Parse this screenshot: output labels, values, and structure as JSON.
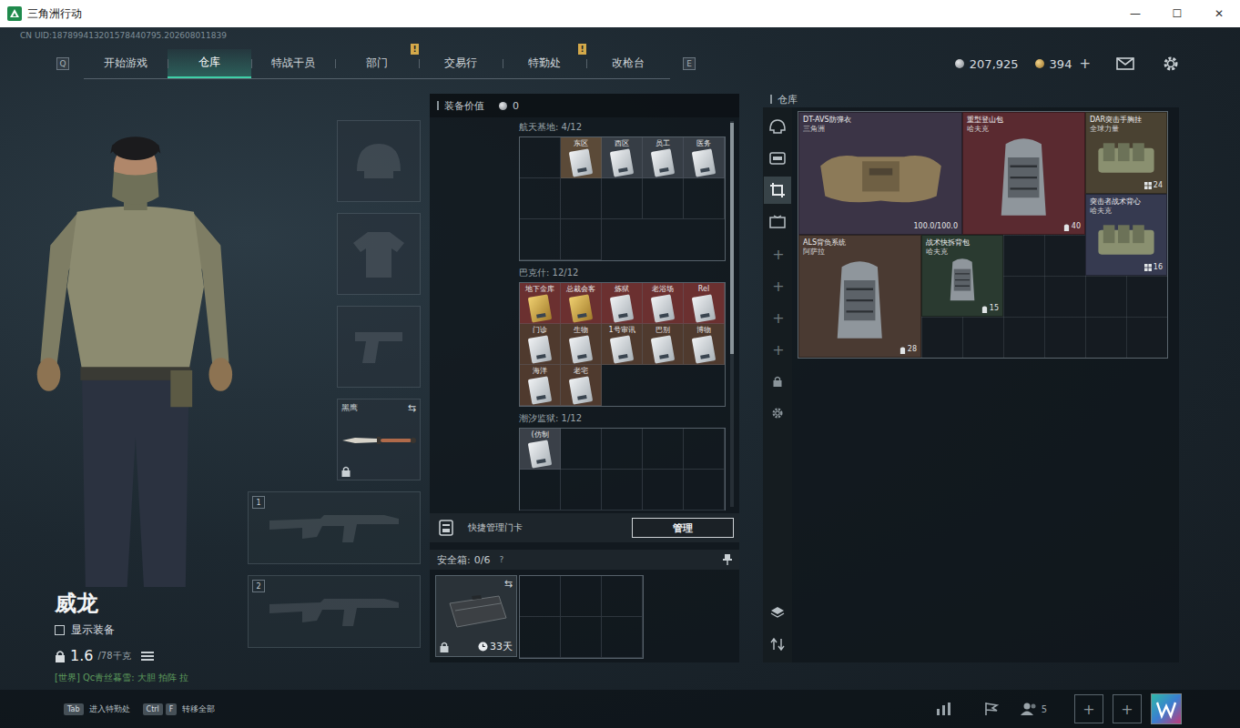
{
  "window": {
    "title": "三角洲行动",
    "controls": [
      "—",
      "☐",
      "✕"
    ]
  },
  "uid": "CN UID:187899413201578440795.202608011839",
  "nav": {
    "left_key": "Q",
    "right_key": "E",
    "tabs": [
      {
        "label": "开始游戏",
        "selected": false,
        "badge": ""
      },
      {
        "label": "仓库",
        "selected": true,
        "badge": ""
      },
      {
        "label": "特战干员",
        "selected": false,
        "badge": ""
      },
      {
        "label": "部门",
        "selected": false,
        "badge": "!"
      },
      {
        "label": "交易行",
        "selected": false,
        "badge": ""
      },
      {
        "label": "特勤处",
        "selected": false,
        "badge": "!"
      },
      {
        "label": "改枪台",
        "selected": false,
        "badge": ""
      }
    ]
  },
  "currency": {
    "coins": "207,925",
    "premium": "394",
    "add": "+"
  },
  "character": {
    "name": "威龙",
    "show_gear": {
      "label": "显示装备",
      "checked": false
    },
    "weight": "1.6",
    "weight_max": "/78千克",
    "chat": "[世界] Qc青丝暮雪: 大胆 拍阵 拉"
  },
  "slots": {
    "melee": {
      "label": "黑鹰",
      "locked": true,
      "swap": "⇆"
    },
    "weapons": [
      "1",
      "2"
    ]
  },
  "equipment_value": {
    "label": "装备价值",
    "value": "0"
  },
  "keycards": [
    {
      "title": "航天基地: 4/12",
      "slots": [
        {
          "filled": false
        },
        {
          "filled": true,
          "label": "东区",
          "kind": "white",
          "color": "#5b4a38"
        },
        {
          "filled": true,
          "label": "西区",
          "kind": "white",
          "color": "#363d45"
        },
        {
          "filled": true,
          "label": "员工",
          "kind": "white",
          "color": "#363d45"
        },
        {
          "filled": true,
          "label": "医务",
          "kind": "white",
          "color": "#363d45"
        },
        {
          "filled": false
        },
        {
          "filled": false
        },
        {
          "filled": false
        },
        {
          "filled": false
        },
        {
          "filled": false
        },
        {
          "filled": false
        },
        {
          "filled": false
        }
      ]
    },
    {
      "title": "巴克什: 12/12",
      "slots": [
        {
          "filled": true,
          "label": "地下金库",
          "kind": "gold",
          "color": "#6b3030"
        },
        {
          "filled": true,
          "label": "总裁会客",
          "kind": "gold",
          "color": "#6b3030"
        },
        {
          "filled": true,
          "label": "炼狱",
          "kind": "white",
          "color": "#6b3030"
        },
        {
          "filled": true,
          "label": "老浴场",
          "kind": "white",
          "color": "#6b3030"
        },
        {
          "filled": true,
          "label": "Rel",
          "kind": "white",
          "color": "#6b3030"
        },
        {
          "filled": true,
          "label": "门诊",
          "kind": "white",
          "color": "#4f3a2e"
        },
        {
          "filled": true,
          "label": "生物",
          "kind": "white",
          "color": "#4f3a2e"
        },
        {
          "filled": true,
          "label": "1号审讯",
          "kind": "white",
          "color": "#4f3a2e"
        },
        {
          "filled": true,
          "label": "巴别",
          "kind": "white",
          "color": "#4f3a2e"
        },
        {
          "filled": true,
          "label": "博物",
          "kind": "white",
          "color": "#4f3a2e"
        },
        {
          "filled": true,
          "label": "海洋",
          "kind": "white",
          "color": "#4f3a2e"
        },
        {
          "filled": true,
          "label": "老宅",
          "kind": "white",
          "color": "#4f3a2e"
        }
      ]
    },
    {
      "title": "潮汐监狱: 1/12",
      "slots": [
        {
          "filled": true,
          "label": "(仿制",
          "kind": "white",
          "color": "#3a4048"
        },
        {
          "filled": false
        },
        {
          "filled": false
        },
        {
          "filled": false
        },
        {
          "filled": false
        },
        {
          "filled": false
        },
        {
          "filled": false
        },
        {
          "filled": false
        },
        {
          "filled": false
        },
        {
          "filled": false
        },
        {
          "filled": false
        },
        {
          "filled": false
        }
      ]
    }
  ],
  "quick_manage": {
    "label": "快捷管理门卡",
    "button": "管理"
  },
  "safe_box": {
    "label": "安全箱:",
    "count": "0/6",
    "help": "?",
    "swap": "⇆",
    "days": "33天",
    "locked": true
  },
  "warehouse": {
    "title": "仓库",
    "tabs": [
      {
        "kind": "helmet",
        "selected": false
      },
      {
        "kind": "vlog",
        "selected": false
      },
      {
        "kind": "crop",
        "selected": true
      },
      {
        "kind": "tv",
        "selected": false
      }
    ],
    "add_buttons": [
      "+",
      "+",
      "+",
      "+"
    ],
    "items": [
      {
        "name": "DT-AVS防弹衣",
        "brand": "三角洲",
        "reading": "100.0/100.0",
        "kind": "armor",
        "color": "#3b3446"
      },
      {
        "name": "重型登山包",
        "brand": "哈夫克",
        "reading": "40",
        "kind": "backpack",
        "color": "#5a2a30"
      },
      {
        "name": "DAR突击手胸挂",
        "brand": "全球力量",
        "reading": "24",
        "kind": "rig",
        "color": "#4a4232"
      },
      {
        "name": "突击者战术背心",
        "brand": "哈夫克",
        "reading": "16",
        "kind": "rig",
        "color": "#363a50"
      },
      {
        "name": "ALS背负系统",
        "brand": "阿萨拉",
        "reading": "28",
        "kind": "backpack",
        "color": "#4a3a32"
      },
      {
        "name": "战术快拆背包",
        "brand": "哈夫克",
        "reading": "15",
        "kind": "backpack",
        "color": "#2a3a30"
      }
    ]
  },
  "bottom_bar": {
    "hints": [
      {
        "keys": [
          "Tab"
        ],
        "label": "进入特勤处"
      },
      {
        "keys": [
          "Ctrl",
          "F"
        ],
        "label": "转移全部"
      }
    ],
    "friends": "5",
    "slots": [
      "+",
      "+"
    ]
  }
}
